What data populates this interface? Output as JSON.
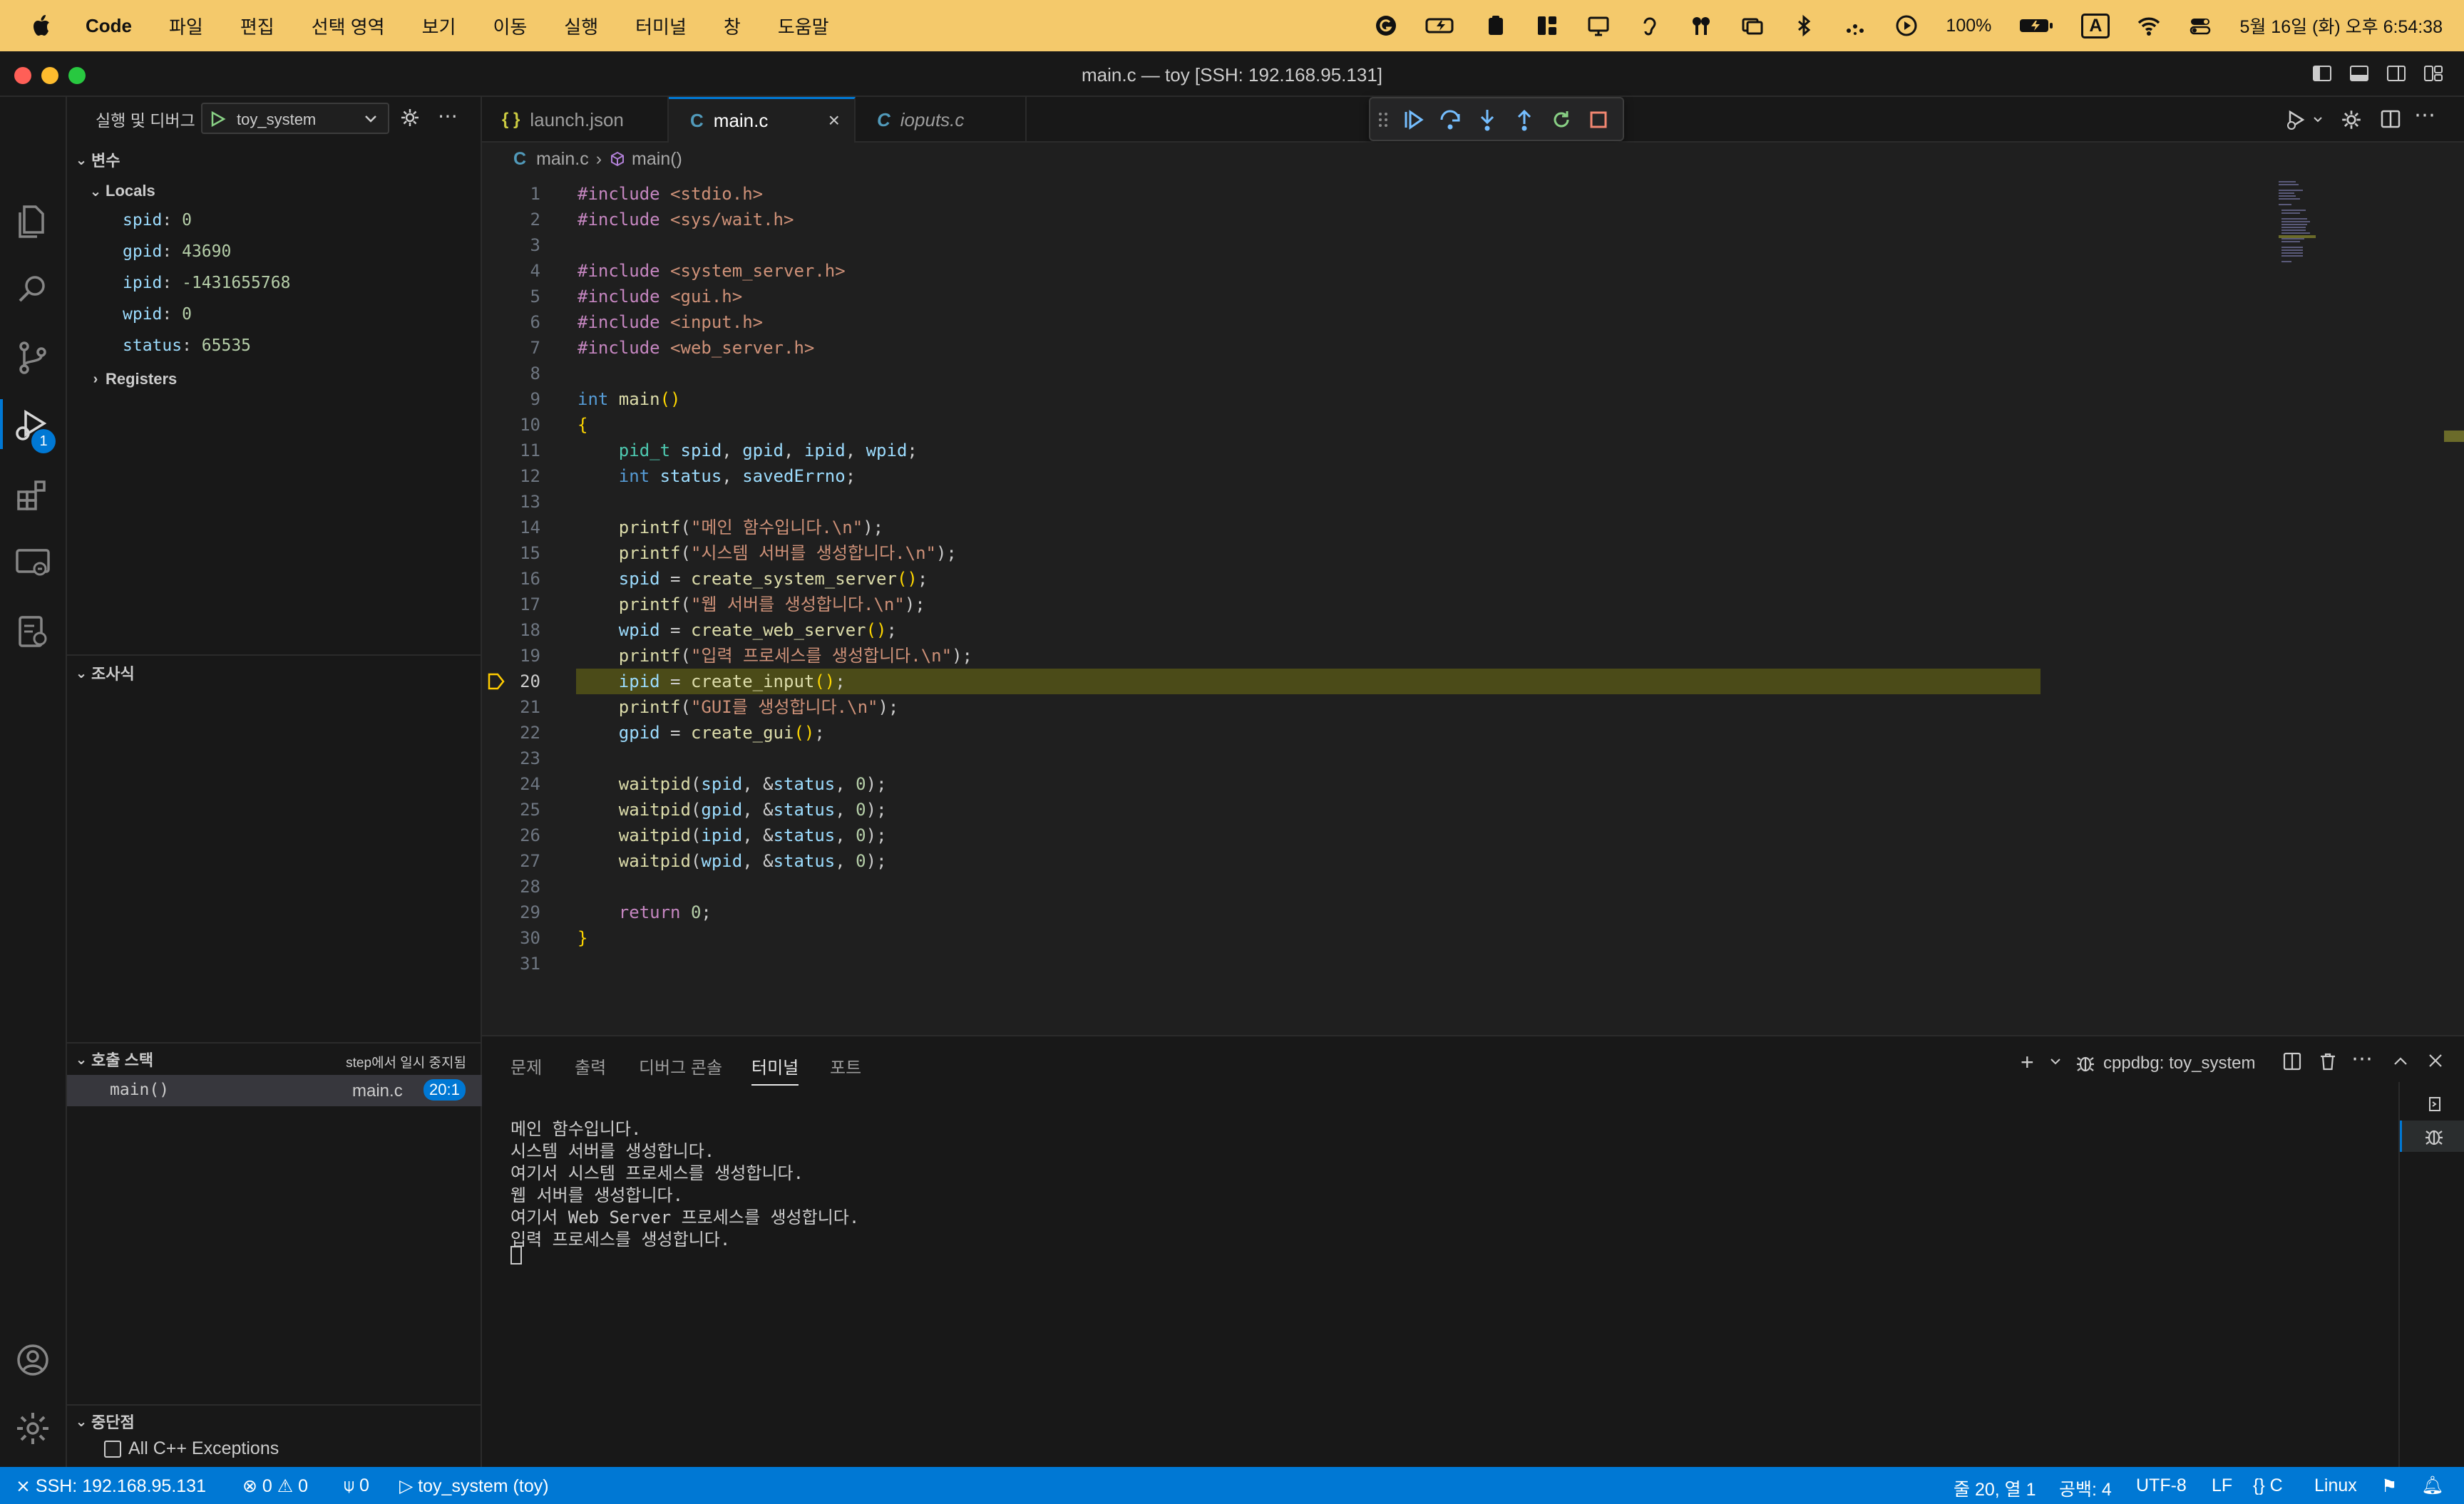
{
  "menubar": {
    "app": "Code",
    "items": [
      "파일",
      "편집",
      "선택 영역",
      "보기",
      "이동",
      "실행",
      "터미널",
      "창",
      "도움말"
    ],
    "battery": "100%",
    "input_method": "A",
    "clock": "5월 16일 (화) 오후 6:54:38"
  },
  "window": {
    "title": "main.c — toy [SSH: 192.168.95.131]"
  },
  "activity_bar": {
    "debug_badge": "1"
  },
  "sidebar": {
    "run_label": "실행 및 디버그",
    "config": "toy_system",
    "variables_header": "변수",
    "locals_header": "Locals",
    "locals": [
      {
        "name": "spid",
        "value": "0"
      },
      {
        "name": "gpid",
        "value": "43690"
      },
      {
        "name": "ipid",
        "value": "-1431655768"
      },
      {
        "name": "wpid",
        "value": "0"
      },
      {
        "name": "status",
        "value": "65535"
      }
    ],
    "registers_header": "Registers",
    "watch_header": "조사식",
    "callstack_header": "호출 스택",
    "callstack_status": "step에서 일시 중지됨",
    "callstack_frame": "main()",
    "callstack_file": "main.c",
    "callstack_pos": "20:1",
    "breakpoints_header": "중단점",
    "breakpoint_item": "All C++ Exceptions"
  },
  "tabs": [
    {
      "label": "launch.json",
      "icon": "{ }"
    },
    {
      "label": "main.c",
      "icon": "C"
    },
    {
      "label": "ioputs.c",
      "icon": "C"
    }
  ],
  "breadcrumb": {
    "file": "main.c",
    "symbol": "main()"
  },
  "code": {
    "current_line": 20,
    "lines": [
      [
        {
          "t": "#include ",
          "c": "pp"
        },
        {
          "t": "<stdio.h>",
          "c": "st"
        }
      ],
      [
        {
          "t": "#include ",
          "c": "pp"
        },
        {
          "t": "<sys/wait.h>",
          "c": "st"
        }
      ],
      [],
      [
        {
          "t": "#include ",
          "c": "pp"
        },
        {
          "t": "<system_server.h>",
          "c": "st"
        }
      ],
      [
        {
          "t": "#include ",
          "c": "pp"
        },
        {
          "t": "<gui.h>",
          "c": "st"
        }
      ],
      [
        {
          "t": "#include ",
          "c": "pp"
        },
        {
          "t": "<input.h>",
          "c": "st"
        }
      ],
      [
        {
          "t": "#include ",
          "c": "pp"
        },
        {
          "t": "<web_server.h>",
          "c": "st"
        }
      ],
      [],
      [
        {
          "t": "int ",
          "c": "kw"
        },
        {
          "t": "main",
          "c": "fn"
        },
        {
          "t": "()",
          "c": "br"
        }
      ],
      [
        {
          "t": "{",
          "c": "br"
        }
      ],
      [
        {
          "t": "    "
        },
        {
          "t": "pid_t ",
          "c": "ty"
        },
        {
          "t": "spid",
          "c": "vr"
        },
        {
          "t": ", "
        },
        {
          "t": "gpid",
          "c": "vr"
        },
        {
          "t": ", "
        },
        {
          "t": "ipid",
          "c": "vr"
        },
        {
          "t": ", "
        },
        {
          "t": "wpid",
          "c": "vr"
        },
        {
          "t": ";"
        }
      ],
      [
        {
          "t": "    "
        },
        {
          "t": "int ",
          "c": "kw"
        },
        {
          "t": "status",
          "c": "vr"
        },
        {
          "t": ", "
        },
        {
          "t": "savedErrno",
          "c": "vr"
        },
        {
          "t": ";"
        }
      ],
      [],
      [
        {
          "t": "    "
        },
        {
          "t": "printf",
          "c": "fn"
        },
        {
          "t": "("
        },
        {
          "t": "\"메인 함수입니다.\\n\"",
          "c": "st"
        },
        {
          "t": ");"
        }
      ],
      [
        {
          "t": "    "
        },
        {
          "t": "printf",
          "c": "fn"
        },
        {
          "t": "("
        },
        {
          "t": "\"시스템 서버를 생성합니다.\\n\"",
          "c": "st"
        },
        {
          "t": ");"
        }
      ],
      [
        {
          "t": "    "
        },
        {
          "t": "spid",
          "c": "vr"
        },
        {
          "t": " = "
        },
        {
          "t": "create_system_server",
          "c": "fn"
        },
        {
          "t": "()",
          "c": "br"
        },
        {
          "t": ";"
        }
      ],
      [
        {
          "t": "    "
        },
        {
          "t": "printf",
          "c": "fn"
        },
        {
          "t": "("
        },
        {
          "t": "\"웹 서버를 생성합니다.\\n\"",
          "c": "st"
        },
        {
          "t": ");"
        }
      ],
      [
        {
          "t": "    "
        },
        {
          "t": "wpid",
          "c": "vr"
        },
        {
          "t": " = "
        },
        {
          "t": "create_web_server",
          "c": "fn"
        },
        {
          "t": "()",
          "c": "br"
        },
        {
          "t": ";"
        }
      ],
      [
        {
          "t": "    "
        },
        {
          "t": "printf",
          "c": "fn"
        },
        {
          "t": "("
        },
        {
          "t": "\"입력 프로세스를 생성합니다.\\n\"",
          "c": "st"
        },
        {
          "t": ");"
        }
      ],
      [
        {
          "t": "    "
        },
        {
          "t": "ipid",
          "c": "vr"
        },
        {
          "t": " = "
        },
        {
          "t": "create_input",
          "c": "fn"
        },
        {
          "t": "()",
          "c": "br"
        },
        {
          "t": ";"
        }
      ],
      [
        {
          "t": "    "
        },
        {
          "t": "printf",
          "c": "fn"
        },
        {
          "t": "("
        },
        {
          "t": "\"GUI를 생성합니다.\\n\"",
          "c": "st"
        },
        {
          "t": ");"
        }
      ],
      [
        {
          "t": "    "
        },
        {
          "t": "gpid",
          "c": "vr"
        },
        {
          "t": " = "
        },
        {
          "t": "create_gui",
          "c": "fn"
        },
        {
          "t": "()",
          "c": "br"
        },
        {
          "t": ";"
        }
      ],
      [],
      [
        {
          "t": "    "
        },
        {
          "t": "waitpid",
          "c": "fn"
        },
        {
          "t": "("
        },
        {
          "t": "spid",
          "c": "vr"
        },
        {
          "t": ", &"
        },
        {
          "t": "status",
          "c": "vr"
        },
        {
          "t": ", "
        },
        {
          "t": "0",
          "c": "nm"
        },
        {
          "t": ");"
        }
      ],
      [
        {
          "t": "    "
        },
        {
          "t": "waitpid",
          "c": "fn"
        },
        {
          "t": "("
        },
        {
          "t": "gpid",
          "c": "vr"
        },
        {
          "t": ", &"
        },
        {
          "t": "status",
          "c": "vr"
        },
        {
          "t": ", "
        },
        {
          "t": "0",
          "c": "nm"
        },
        {
          "t": ");"
        }
      ],
      [
        {
          "t": "    "
        },
        {
          "t": "waitpid",
          "c": "fn"
        },
        {
          "t": "("
        },
        {
          "t": "ipid",
          "c": "vr"
        },
        {
          "t": ", &"
        },
        {
          "t": "status",
          "c": "vr"
        },
        {
          "t": ", "
        },
        {
          "t": "0",
          "c": "nm"
        },
        {
          "t": ");"
        }
      ],
      [
        {
          "t": "    "
        },
        {
          "t": "waitpid",
          "c": "fn"
        },
        {
          "t": "("
        },
        {
          "t": "wpid",
          "c": "vr"
        },
        {
          "t": ", &"
        },
        {
          "t": "status",
          "c": "vr"
        },
        {
          "t": ", "
        },
        {
          "t": "0",
          "c": "nm"
        },
        {
          "t": ");"
        }
      ],
      [],
      [
        {
          "t": "    "
        },
        {
          "t": "return ",
          "c": "pp"
        },
        {
          "t": "0",
          "c": "nm"
        },
        {
          "t": ";"
        }
      ],
      [
        {
          "t": "}",
          "c": "br"
        }
      ],
      []
    ]
  },
  "panel": {
    "tabs": [
      "문제",
      "출력",
      "디버그 콘솔",
      "터미널",
      "포트"
    ],
    "active_tab": "터미널",
    "session": "cppdbg: toy_system",
    "terminal_lines": [
      "메인 함수입니다.",
      "시스템 서버를 생성합니다.",
      "여기서 시스템 프로세스를 생성합니다.",
      "웹 서버를 생성합니다.",
      "여기서 Web Server 프로세스를 생성합니다.",
      "입력 프로세스를 생성합니다."
    ]
  },
  "statusbar": {
    "remote": "SSH: 192.168.95.131",
    "errors": "0",
    "warnings": "0",
    "ports": "0",
    "debug_target": "toy_system (toy)",
    "position": "줄 20, 열 1",
    "spaces": "공백: 4",
    "encoding": "UTF-8",
    "eol": "LF",
    "language": "C",
    "platform": "Linux"
  },
  "colors": {
    "menubar": "#f4c96b",
    "statusbar": "#0078d4",
    "current_line": "#4b4b18",
    "breakpoint_arrow": "#ffcc00"
  }
}
